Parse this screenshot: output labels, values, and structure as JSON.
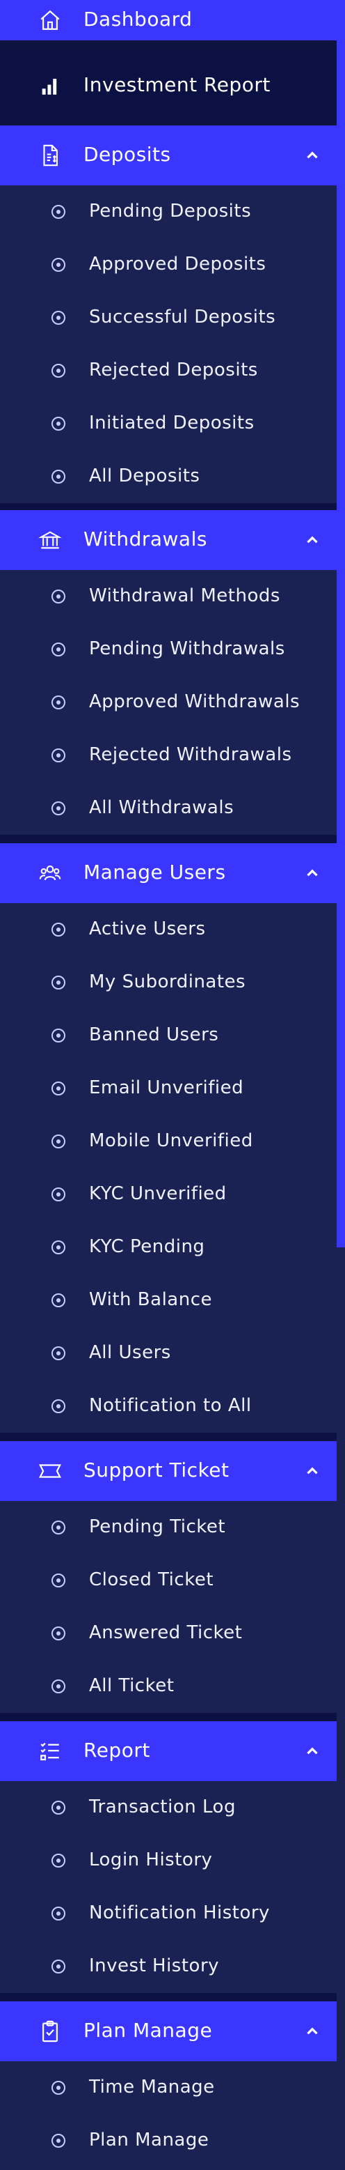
{
  "sidebar": {
    "dashboard": {
      "label": "Dashboard",
      "icon": "home-icon"
    },
    "investment_report": {
      "label": "Investment Report",
      "icon": "bar-chart-icon"
    },
    "sections": [
      {
        "title": "Deposits",
        "icon": "deposit-icon",
        "items": [
          "Pending Deposits",
          "Approved Deposits",
          "Successful Deposits",
          "Rejected Deposits",
          "Initiated Deposits",
          "All Deposits"
        ]
      },
      {
        "title": "Withdrawals",
        "icon": "bank-icon",
        "items": [
          "Withdrawal Methods",
          "Pending Withdrawals",
          "Approved Withdrawals",
          "Rejected Withdrawals",
          "All Withdrawals"
        ]
      },
      {
        "title": "Manage Users",
        "icon": "users-icon",
        "items": [
          "Active Users",
          "My Subordinates",
          "Banned Users",
          "Email Unverified",
          "Mobile Unverified",
          "KYC Unverified",
          "KYC Pending",
          "With Balance",
          "All Users",
          "Notification to All"
        ]
      },
      {
        "title": "Support Ticket",
        "icon": "ticket-icon",
        "items": [
          "Pending Ticket",
          "Closed Ticket",
          "Answered Ticket",
          "All Ticket"
        ]
      },
      {
        "title": "Report",
        "icon": "list-icon",
        "items": [
          "Transaction Log",
          "Login History",
          "Notification History",
          "Invest History"
        ]
      },
      {
        "title": "Plan Manage",
        "icon": "clipboard-check-icon",
        "items": [
          "Time Manage",
          "Plan Manage"
        ]
      }
    ]
  },
  "colors": {
    "accent": "#3b36ff",
    "panel": "#1a2153",
    "dark": "#0b1142"
  }
}
